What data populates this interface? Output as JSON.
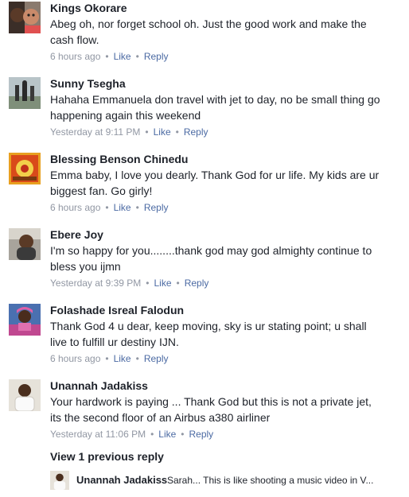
{
  "comments": [
    {
      "name": "Kings Okorare",
      "avatar": "family-photo",
      "text": "Abeg oh, nor forget school oh. Just the good work and make the cash flow.",
      "time": "6 hours ago",
      "like": "Like",
      "reply": "Reply"
    },
    {
      "name": "Sunny Tsegha",
      "avatar": "outdoor-photo",
      "text": "Hahaha  Emmanuela don travel with jet to day, no be small thing go happening again this weekend",
      "time": "Yesterday at 9:11 PM",
      "like": "Like",
      "reply": "Reply"
    },
    {
      "name": "Blessing Benson Chinedu",
      "avatar": "art-photo",
      "text": "Emma baby, I love you dearly. Thank God for ur life. My kids are ur biggest fan. Go girly!",
      "time": "6 hours ago",
      "like": "Like",
      "reply": "Reply"
    },
    {
      "name": "Ebere Joy",
      "avatar": "portrait-photo",
      "text": "I'm so happy for you........thank god may god almighty continue to bless you ijmn",
      "time": "Yesterday at 9:39 PM",
      "like": "Like",
      "reply": "Reply"
    },
    {
      "name": "Folashade Isreal Falodun",
      "avatar": "pink-portrait-photo",
      "text": "Thank God 4 u dear, keep moving, sky is ur stating point; u shall live to fulfill ur destiny IJN.",
      "time": "6 hours ago",
      "like": "Like",
      "reply": "Reply"
    },
    {
      "name": "Unannah Jadakiss",
      "avatar": "white-shirt-photo",
      "text": "Your hardwork is paying ... Thank God but this is not a private jet, its the second floor of an Airbus a380 airliner",
      "time": "Yesterday at 11:06 PM",
      "like": "Like",
      "reply": "Reply"
    }
  ],
  "view_previous": "View 1 previous reply",
  "reply_preview": {
    "name": "Unannah Jadakiss",
    "snippet": "Sarah... This is like shooting a music video in V..."
  },
  "colors": {
    "text": "#1d2129",
    "meta": "#9197a3",
    "action": "#4b6aa3"
  }
}
